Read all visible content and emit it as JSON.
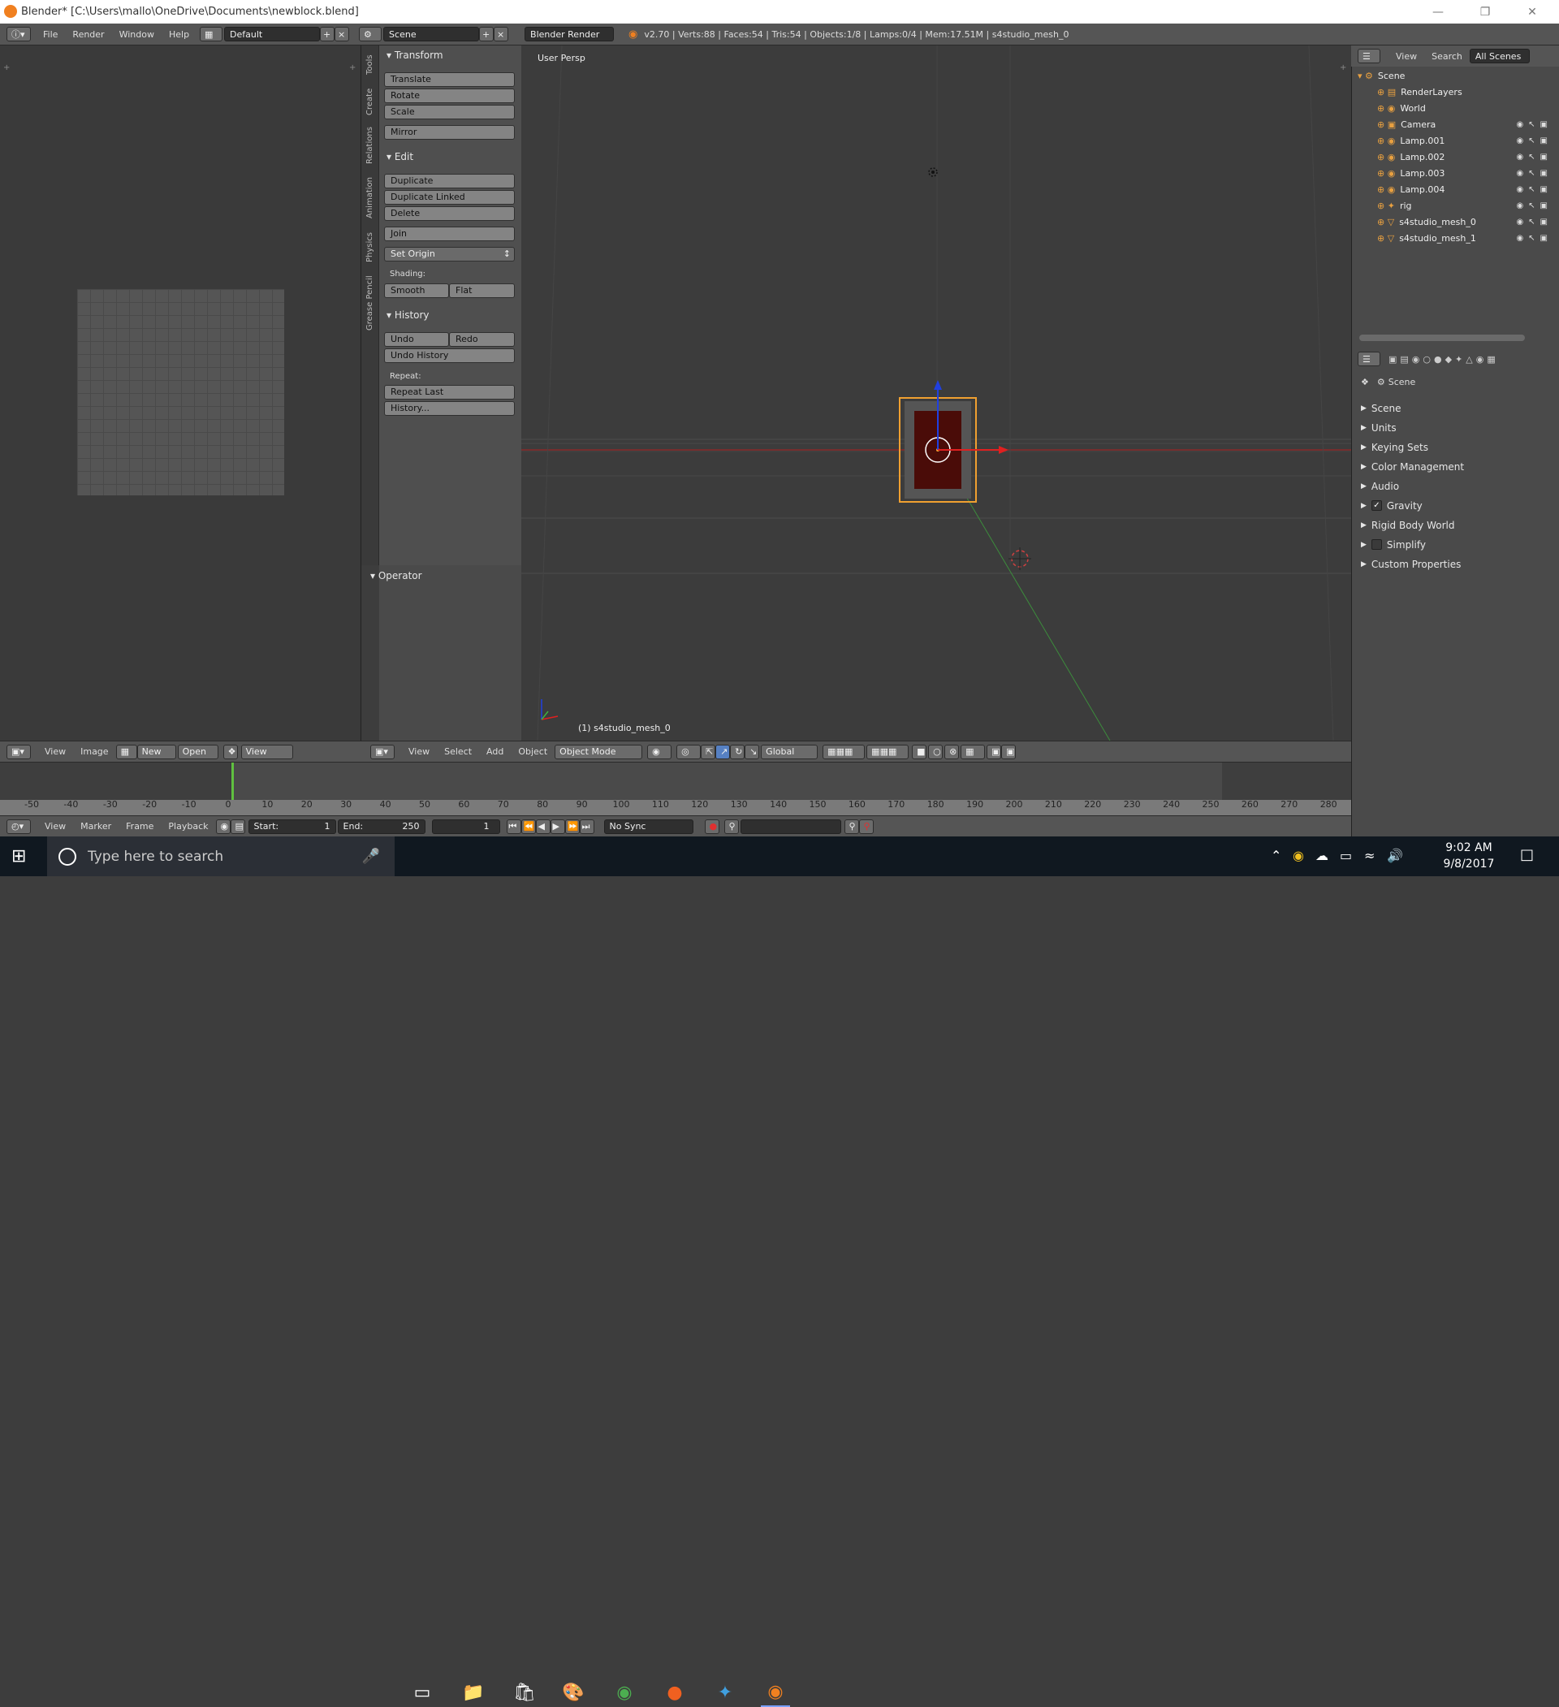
{
  "window": {
    "title": "Blender* [C:\\Users\\mallo\\OneDrive\\Documents\\newblock.blend]"
  },
  "menu": [
    "File",
    "Render",
    "Window",
    "Help"
  ],
  "layout_name": "Default",
  "scene_name": "Scene",
  "render_engine": "Blender Render",
  "stats": "v2.70 | Verts:88 | Faces:54 | Tris:54 | Objects:1/8 | Lamps:0/4 | Mem:17.51M | s4studio_mesh_0",
  "tool_tabs": [
    "Tools",
    "Create",
    "Relations",
    "Animation",
    "Physics",
    "Grease Pencil"
  ],
  "toolshelf": {
    "transform": {
      "title": "Transform",
      "buttons": [
        "Translate",
        "Rotate",
        "Scale",
        "Mirror"
      ]
    },
    "edit": {
      "title": "Edit",
      "buttons": [
        "Duplicate",
        "Duplicate Linked",
        "Delete",
        "Join"
      ],
      "set_origin": "Set Origin",
      "shading_label": "Shading:",
      "smooth": "Smooth",
      "flat": "Flat"
    },
    "history": {
      "title": "History",
      "undo": "Undo",
      "redo": "Redo",
      "undo_history": "Undo History",
      "repeat_label": "Repeat:",
      "repeat_last": "Repeat Last",
      "history_btn": "History..."
    },
    "operator": "Operator"
  },
  "viewport": {
    "label": "User Persp",
    "object_label": "(1) s4studio_mesh_0"
  },
  "image_editor_header": {
    "view": "View",
    "image": "Image",
    "new": "New",
    "open": "Open",
    "view2": "View"
  },
  "viewport_header": {
    "view": "View",
    "select": "Select",
    "add": "Add",
    "object": "Object",
    "mode": "Object Mode",
    "orientation": "Global"
  },
  "outliner": {
    "header": {
      "view": "View",
      "search": "Search",
      "filter": "All Scenes"
    },
    "items": [
      {
        "name": "Scene",
        "depth": 0,
        "icon": "scene-icon"
      },
      {
        "name": "RenderLayers",
        "depth": 1,
        "icon": "renderlayers-icon"
      },
      {
        "name": "World",
        "depth": 1,
        "icon": "world-icon"
      },
      {
        "name": "Camera",
        "depth": 1,
        "icon": "camera-icon"
      },
      {
        "name": "Lamp.001",
        "depth": 1,
        "icon": "lamp-icon"
      },
      {
        "name": "Lamp.002",
        "depth": 1,
        "icon": "lamp-icon"
      },
      {
        "name": "Lamp.003",
        "depth": 1,
        "icon": "lamp-icon"
      },
      {
        "name": "Lamp.004",
        "depth": 1,
        "icon": "lamp-icon"
      },
      {
        "name": "rig",
        "depth": 1,
        "icon": "armature-icon"
      },
      {
        "name": "s4studio_mesh_0",
        "depth": 1,
        "icon": "mesh-icon"
      },
      {
        "name": "s4studio_mesh_1",
        "depth": 1,
        "icon": "mesh-icon"
      }
    ]
  },
  "properties": {
    "context": "Scene",
    "panels": [
      "Scene",
      "Units",
      "Keying Sets",
      "Color Management",
      "Audio",
      "Gravity",
      "Rigid Body World",
      "Simplify",
      "Custom Properties"
    ]
  },
  "timeline": {
    "ticks": [
      "-50",
      "-40",
      "-30",
      "-20",
      "-10",
      "0",
      "10",
      "20",
      "30",
      "40",
      "50",
      "60",
      "70",
      "80",
      "90",
      "100",
      "110",
      "120",
      "130",
      "140",
      "150",
      "160",
      "170",
      "180",
      "190",
      "200",
      "210",
      "220",
      "230",
      "240",
      "250",
      "260",
      "270",
      "280"
    ],
    "current_frame": 1,
    "menu": [
      "View",
      "Marker",
      "Frame",
      "Playback"
    ],
    "start_label": "Start:",
    "start": "1",
    "end_label": "End:",
    "end": "250",
    "frame": "1",
    "sync": "No Sync"
  },
  "taskbar": {
    "search_placeholder": "Type here to search",
    "time": "9:02 AM",
    "date": "9/8/2017"
  },
  "colors": {
    "selection_outline": "#f0a030",
    "axis_x": "#e02020",
    "axis_y": "#40b040",
    "axis_z": "#2040e0",
    "mesh": "#4a0c08"
  }
}
